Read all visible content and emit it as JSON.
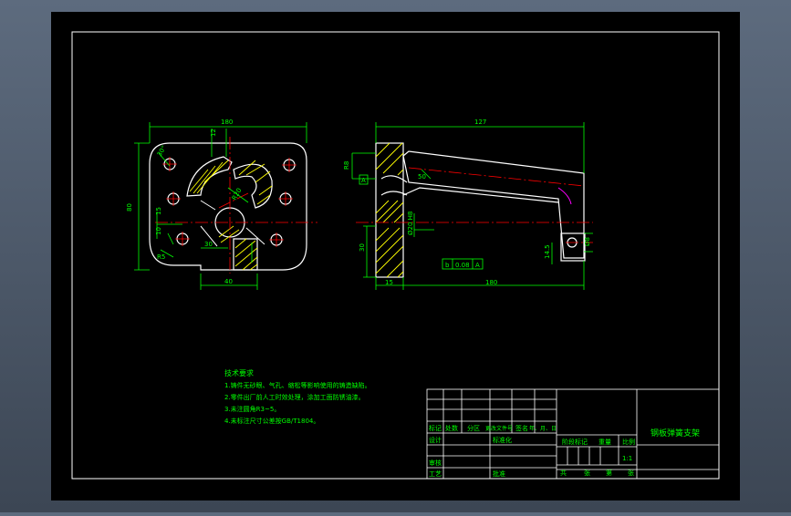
{
  "colors": {
    "sheet_bg": "#000000",
    "frame": "#ffffff",
    "outline": "#ffffff",
    "dimension": "#00ff00",
    "centerline": "#ff0000",
    "hatch": "#ffff00",
    "accent": "#ff00ff"
  },
  "front_view": {
    "dim_top": "180",
    "dim_left": "80",
    "dim_bottom": "40",
    "dim_small_top": "12",
    "dim_15": "15",
    "dim_r10": "10",
    "dim_30": "30",
    "dim_r20": "R20",
    "dim_r5": "R5",
    "dim_angle": "30°"
  },
  "side_view": {
    "dim_top": "127",
    "dim_base_left": "15",
    "dim_base_right": "180",
    "dim_height": "30",
    "dim_left_top": "R8",
    "dim_left_mid": "A",
    "dim_hole": "Ø20 H8",
    "dim_r50": "50",
    "dim_right": "Ø8",
    "dim_right_small": "14.5",
    "tolerance": [
      "b",
      "0.08",
      "A"
    ]
  },
  "notes": {
    "title": "技术要求",
    "items": [
      "1.铸件无砂眼、气孔、缩松等影响使用的铸造缺陷。",
      "2.零件出厂前人工时效处理，涂加工面防锈油漆。",
      "3.未注圆角R3~5。",
      "4.未标注尺寸公差按GB/T1804。"
    ]
  },
  "title_block": {
    "drawing_name": "钢板弹簧支架",
    "header_labels": [
      "标记",
      "处数",
      "分区",
      "更改文件号",
      "签名",
      "年、月、日"
    ],
    "row_labels": [
      "设计",
      "标准化",
      "审核",
      "工艺",
      "批准"
    ],
    "stage_labels": [
      "阶段标记",
      "重量",
      "比例"
    ],
    "scale": "1:1",
    "sheet_labels": [
      "共",
      "张",
      "第",
      "张"
    ]
  }
}
